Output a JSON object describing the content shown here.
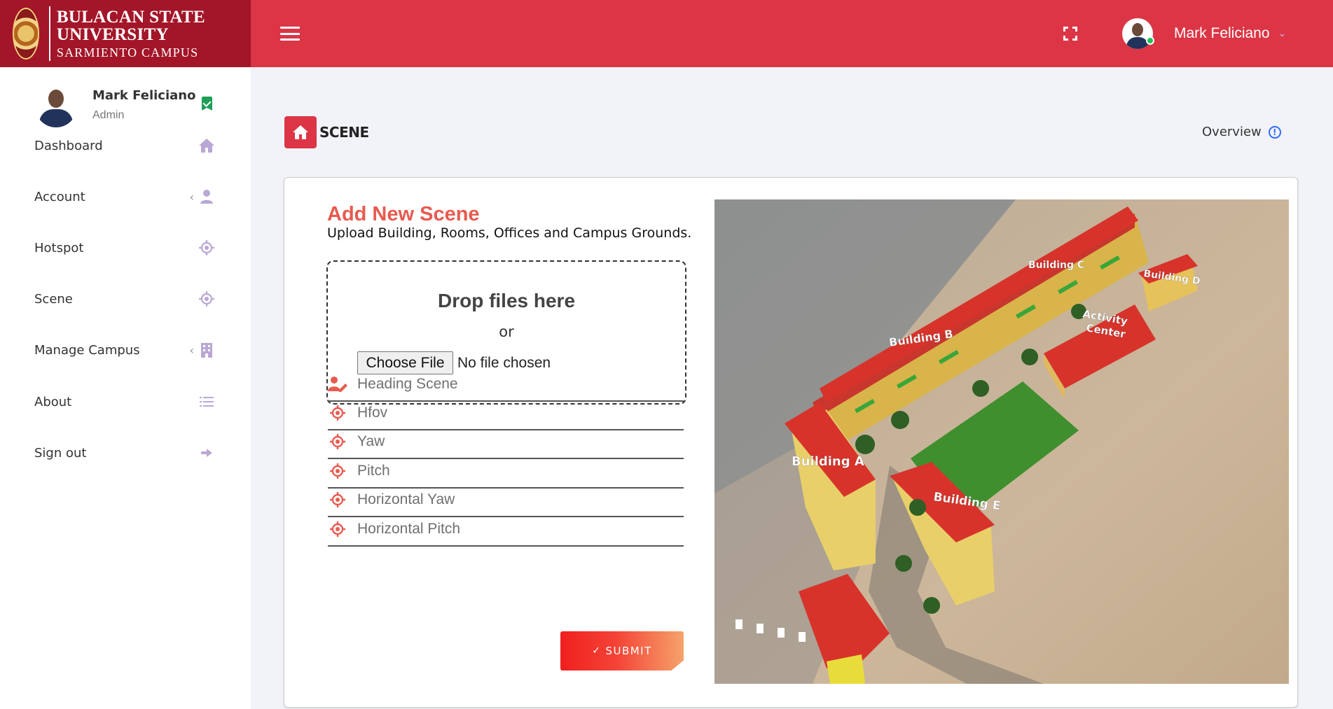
{
  "brand": {
    "title": "BULACAN STATE UNIVERSITY",
    "subtitle": "SARMIENTO CAMPUS"
  },
  "header": {
    "user_name": "Mark Feliciano",
    "menu_icon": "hamburger-icon",
    "fullscreen_icon": "fullscreen-icon"
  },
  "sidebar": {
    "profile": {
      "name": "Mark Feliciano",
      "role": "Admin"
    },
    "items": [
      {
        "label": "Dashboard",
        "icon": "home-icon",
        "has_arrow": false
      },
      {
        "label": "Account",
        "icon": "user-icon",
        "has_arrow": true
      },
      {
        "label": "Hotspot",
        "icon": "crosshair-icon",
        "has_arrow": false
      },
      {
        "label": "Scene",
        "icon": "crosshair-icon",
        "has_arrow": false
      },
      {
        "label": "Manage Campus",
        "icon": "building-icon",
        "has_arrow": true
      },
      {
        "label": "About",
        "icon": "list-icon",
        "has_arrow": false
      },
      {
        "label": "Sign out",
        "icon": "arrow-right-icon",
        "has_arrow": false
      }
    ]
  },
  "page": {
    "title": "SCENE",
    "overview_label": "Overview"
  },
  "form": {
    "title": "Add New Scene",
    "subtitle": "Upload Building, Rooms, Offices and Campus Grounds.",
    "dropzone": {
      "title": "Drop files here",
      "or": "or",
      "choose_label": "Choose File",
      "no_file": "No file chosen"
    },
    "fields": [
      {
        "placeholder": "Heading Scene",
        "icon": "user-edit-icon"
      },
      {
        "placeholder": "Hfov",
        "icon": "crosshair-icon"
      },
      {
        "placeholder": "Yaw",
        "icon": "crosshair-icon"
      },
      {
        "placeholder": "Pitch",
        "icon": "crosshair-icon"
      },
      {
        "placeholder": "Horizontal Yaw",
        "icon": "crosshair-icon"
      },
      {
        "placeholder": "Horizontal Pitch",
        "icon": "crosshair-icon"
      }
    ],
    "submit_label": "SUBMIT"
  },
  "campus_map": {
    "labels": {
      "a": "Building A",
      "b": "Building B",
      "c": "Building C",
      "d": "Building D",
      "e": "Building E",
      "activity_1": "Activity",
      "activity_2": "Center"
    }
  },
  "colors": {
    "header": "#dc3545",
    "brand": "#a31528",
    "accent": "#e85a4f",
    "roof": "#d7332b",
    "grass": "#3f8f2e"
  }
}
